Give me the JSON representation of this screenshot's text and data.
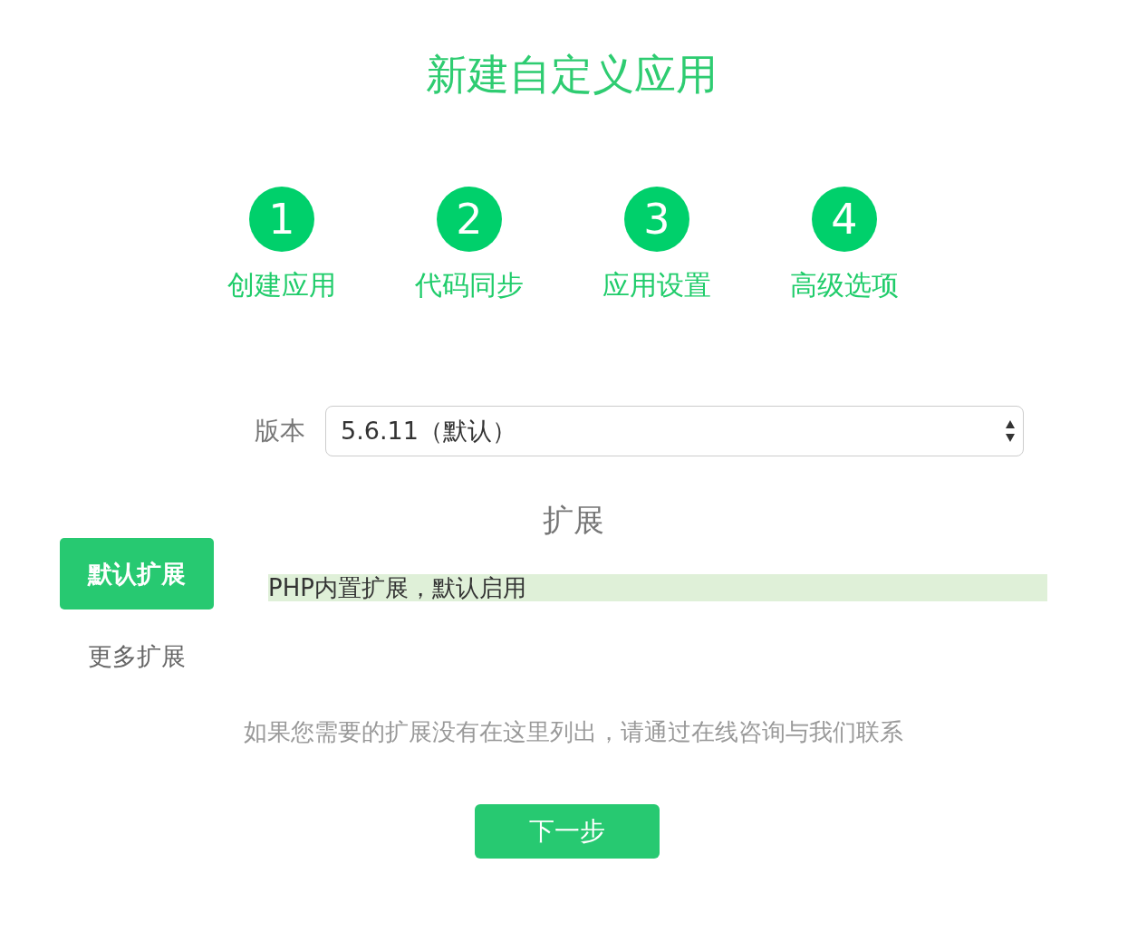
{
  "title": "新建自定义应用",
  "steps": [
    {
      "number": "1",
      "label": "创建应用"
    },
    {
      "number": "2",
      "label": "代码同步"
    },
    {
      "number": "3",
      "label": "应用设置"
    },
    {
      "number": "4",
      "label": "高级选项"
    }
  ],
  "version": {
    "label": "版本",
    "value": "5.6.11（默认）"
  },
  "extensions": {
    "heading": "扩展",
    "tabs": [
      {
        "label": "默认扩展",
        "selected": true
      },
      {
        "label": "更多扩展",
        "selected": false
      }
    ],
    "items": [
      "PHP内置扩展，默认启用"
    ]
  },
  "note": "如果您需要的扩展没有在这里列出，请通过在线咨询与我们联系",
  "next_button": "下一步"
}
